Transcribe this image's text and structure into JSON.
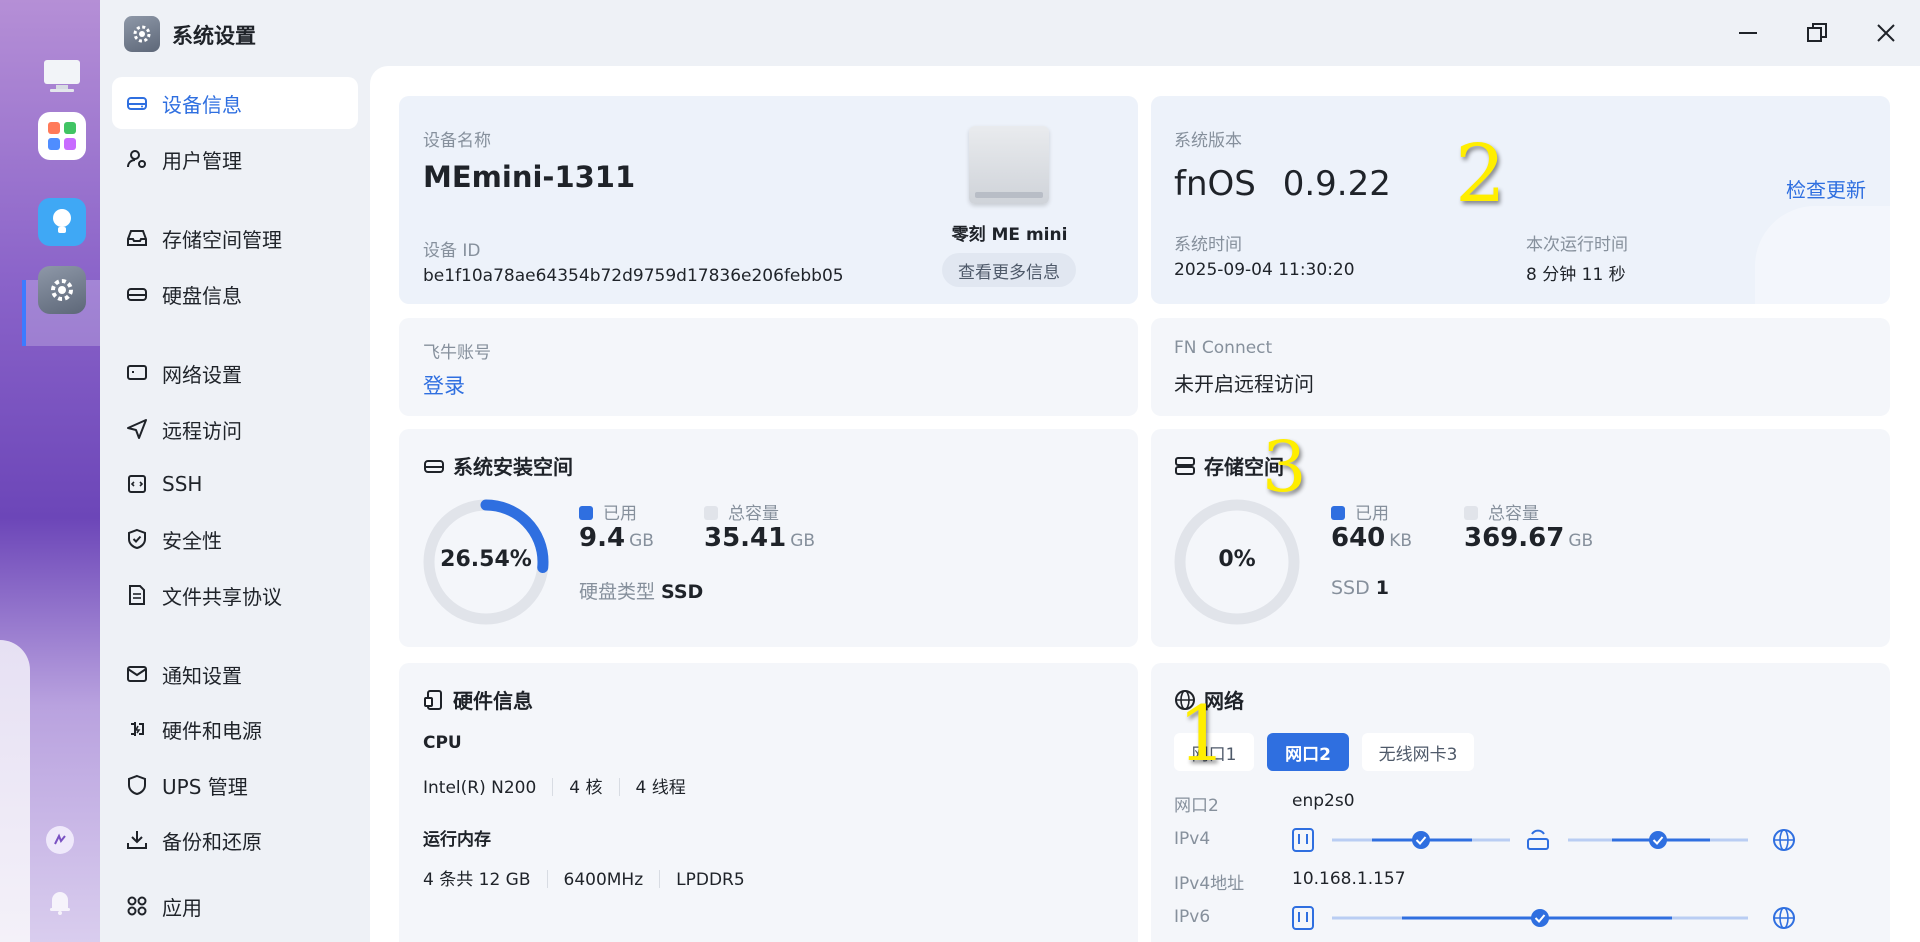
{
  "window": {
    "title": "系统设置"
  },
  "sidebar": {
    "items": [
      {
        "label": "设备信息",
        "icon": "drive-icon",
        "active": true
      },
      {
        "label": "用户管理",
        "icon": "user-gear-icon"
      },
      {
        "label": "存储空间管理",
        "icon": "inbox-icon"
      },
      {
        "label": "硬盘信息",
        "icon": "disk-icon"
      },
      {
        "label": "网络设置",
        "icon": "monitor-icon"
      },
      {
        "label": "远程访问",
        "icon": "send-icon"
      },
      {
        "label": "SSH",
        "icon": "terminal-icon"
      },
      {
        "label": "安全性",
        "icon": "shield-check-icon"
      },
      {
        "label": "文件共享协议",
        "icon": "document-icon"
      },
      {
        "label": "通知设置",
        "icon": "mail-icon"
      },
      {
        "label": "硬件和电源",
        "icon": "power-plug-icon"
      },
      {
        "label": "UPS 管理",
        "icon": "shield-icon"
      },
      {
        "label": "备份和还原",
        "icon": "download-tray-icon"
      },
      {
        "label": "应用",
        "icon": "apps-grid-icon"
      }
    ]
  },
  "device": {
    "name_label": "设备名称",
    "name": "MEmini-1311",
    "id_label": "设备 ID",
    "id": "be1f10a78ae64354b72d9759d17836e206febb05",
    "model": "零刻 ME mini",
    "more_button": "查看更多信息"
  },
  "system": {
    "version_label": "系统版本",
    "os": "fnOS",
    "version": "0.9.22",
    "check_update": "检查更新",
    "time_label": "系统时间",
    "time": "2025-09-04 11:30:20",
    "uptime_label": "本次运行时间",
    "uptime": "8 分钟 11 秒"
  },
  "account": {
    "label": "飞牛账号",
    "login": "登录"
  },
  "fnconnect": {
    "label": "FN Connect",
    "status": "未开启远程访问"
  },
  "sys_space": {
    "title": "系统安装空间",
    "percent_text": "26.54%",
    "percent": 26.54,
    "used_label": "已用",
    "used_value": "9.4",
    "used_unit": "GB",
    "total_label": "总容量",
    "total_value": "35.41",
    "total_unit": "GB",
    "disk_type_label": "硬盘类型",
    "disk_type": "SSD"
  },
  "storage": {
    "title": "存储空间",
    "percent_text": "0%",
    "percent": 0,
    "used_label": "已用",
    "used_value": "640",
    "used_unit": "KB",
    "total_label": "总容量",
    "total_value": "369.67",
    "total_unit": "GB",
    "ssd_label": "SSD",
    "ssd_count": "1"
  },
  "hardware": {
    "title": "硬件信息",
    "cpu_label": "CPU",
    "cpu_model": "Intel(R) N200",
    "cpu_cores": "4 核",
    "cpu_threads": "4 线程",
    "mem_label": "运行内存",
    "mem_total": "4 条共 12 GB",
    "mem_speed": "6400MHz",
    "mem_type": "LPDDR5"
  },
  "network": {
    "title": "网络",
    "tabs": [
      "网口1",
      "网口2",
      "无线网卡3"
    ],
    "active_tab": 1,
    "port_label": "网口2",
    "port_value": "enp2s0",
    "ipv4_label": "IPv4",
    "ipv4_addr_label": "IPv4地址",
    "ipv4_addr": "10.168.1.157",
    "ipv6_label": "IPv6"
  },
  "annotations": [
    "1",
    "2",
    "3"
  ],
  "colors": {
    "accent": "#2f6fe0",
    "ring_track": "#e1e4ea",
    "annotation": "#ffee00"
  }
}
